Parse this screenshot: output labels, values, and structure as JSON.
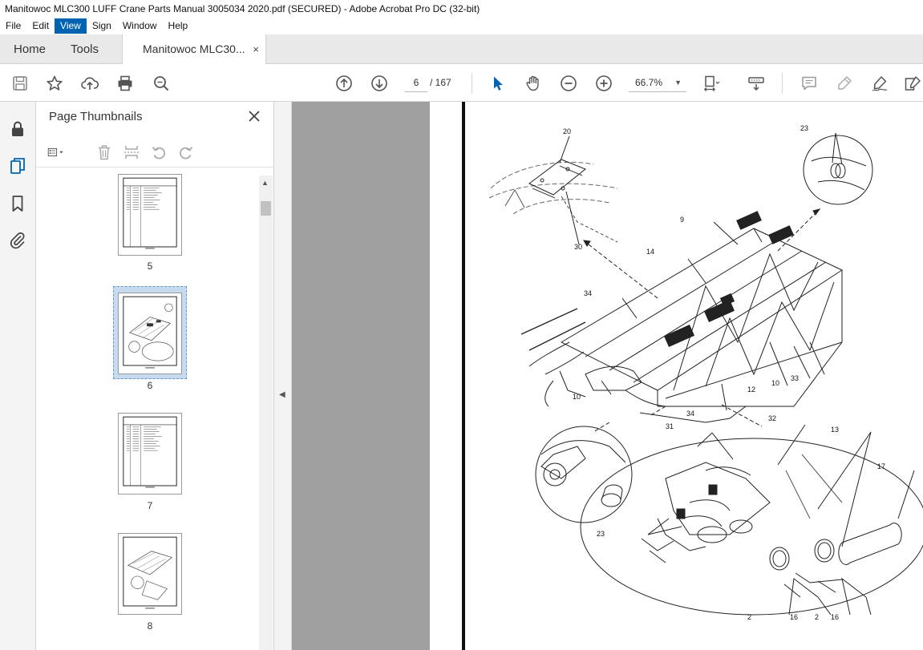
{
  "window": {
    "title": "Manitowoc MLC300 LUFF Crane Parts Manual 3005034 2020.pdf (SECURED) - Adobe Acrobat Pro DC (32-bit)"
  },
  "menu": [
    "File",
    "Edit",
    "View",
    "Sign",
    "Window",
    "Help"
  ],
  "menu_active": "View",
  "tabs": {
    "home": "Home",
    "tools": "Tools",
    "document": "Manitowoc MLC30...",
    "close": "×"
  },
  "toolbar": {
    "page_current": "6",
    "page_total": "/ 167",
    "zoom": "66.7%"
  },
  "thumbnails_panel": {
    "title": "Page Thumbnails",
    "pages": [
      {
        "label": "5"
      },
      {
        "label": "6"
      },
      {
        "label": "7"
      },
      {
        "label": "8"
      }
    ]
  },
  "drawing": {
    "callouts": [
      "20",
      "23",
      "9",
      "14",
      "30",
      "34",
      "10",
      "12",
      "10",
      "33",
      "34",
      "31",
      "32",
      "13",
      "17",
      "23",
      "2",
      "16",
      "2",
      "16"
    ]
  },
  "colors": {
    "accent": "#0063b1",
    "selected_thumb": "#c6dbef",
    "doc_background": "#a0a0a0"
  }
}
